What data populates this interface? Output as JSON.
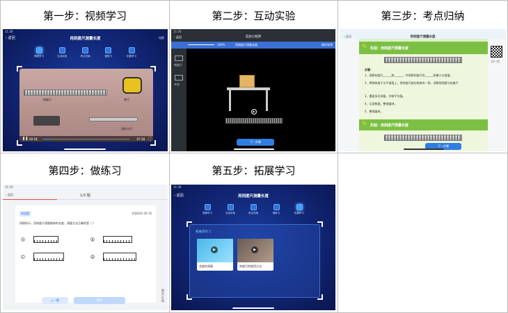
{
  "headers": {
    "step1": "第一步：视频学习",
    "step2": "第二步：互动实验",
    "step3": "第三步：考点归纳",
    "step4": "第四步：做练习",
    "step5": "第五步：拓展学习"
  },
  "screen1": {
    "status_time": "11:30",
    "back": "返回",
    "title": "用刻度尺测量长度",
    "right": "电影",
    "steps": [
      "视频学习",
      "互动实验",
      "考点归纳",
      "做练习",
      "拓展学习"
    ],
    "labels": {
      "ruler": "刻度尺",
      "tape": "卷尺",
      "vernier": "游标卡尺"
    },
    "time_left": "00:18",
    "time_right": "07:38"
  },
  "screen2": {
    "status_time": "11:30",
    "back": "返回",
    "title": "实验小程序",
    "toolbar_title": "用刻度尺测量长度",
    "zoom": "100%",
    "side_items": [
      "刻度尺",
      "木块"
    ],
    "next_button": "下一步骤",
    "right_link": "操作说明"
  },
  "screen3": {
    "back": "返回",
    "title": "用刻度尺测量长度",
    "section_title": "实验：用刻度尺测量长度",
    "steps_label": "步骤：",
    "lines": [
      "1、观察刻度尺______和______，并观察刻度尺的______和最小分度值。",
      "2、将物体放于水平桌面上，把刻度尺放在物体的一侧，读数视线要与刻度尺",
      "3、重复多次测量，并取平均值。",
      "4、记录数据，整理器材。",
      "5、整理器材。"
    ],
    "next_button": "下一步骤",
    "qr_text": "扫一扫"
  },
  "screen4": {
    "status_time": "11:30",
    "back": "返回",
    "progress": "1/3 题",
    "type_badge": "单选题",
    "counter": "作答时间 00:16",
    "question": "如图所示，用刻度尺测量物体的长度，测量方法正确的是（   ）",
    "options": [
      "A",
      "B",
      "C",
      "D"
    ],
    "prev_button": "上一题",
    "submit_button": "提交",
    "side_note": "题目反馈"
  },
  "screen5": {
    "status_time": "11:30",
    "back": "返回",
    "title": "用刻度尺测量长度",
    "steps": [
      "视频学习",
      "互动实验",
      "考点归纳",
      "做练习",
      "拓展学习"
    ],
    "panel_title": "拓展资料 1",
    "videos": [
      "长度的测量",
      "刻度尺的使用方法"
    ]
  }
}
